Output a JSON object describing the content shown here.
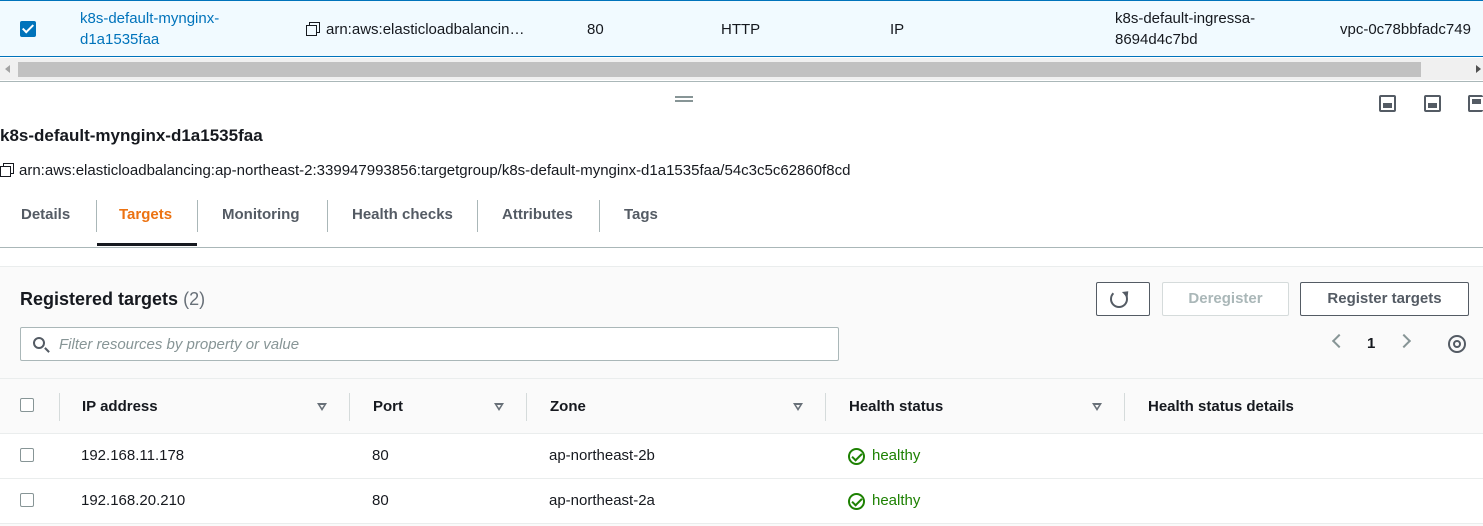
{
  "top_row": {
    "name": "k8s-default-mynginx-d1a1535faa",
    "name_line1": "k8s-default-mynginx-",
    "name_line2": "d1a1535faa",
    "arn": "arn:aws:elasticloadbalancin…",
    "port": "80",
    "protocol": "HTTP",
    "target_type": "IP",
    "load_balancer_line1": "k8s-default-ingressa-",
    "load_balancer_line2": "8694d4c7bd",
    "vpc": "vpc-0c78bbfadc749"
  },
  "detail": {
    "title": "k8s-default-mynginx-d1a1535faa",
    "arn": "arn:aws:elasticloadbalancing:ap-northeast-2:339947993856:targetgroup/k8s-default-mynginx-d1a1535faa/54c3c5c62860f8cd"
  },
  "tabs": [
    {
      "label": "Details"
    },
    {
      "label": "Targets"
    },
    {
      "label": "Monitoring"
    },
    {
      "label": "Health checks"
    },
    {
      "label": "Attributes"
    },
    {
      "label": "Tags"
    }
  ],
  "targets": {
    "title": "Registered targets",
    "count": "(2)",
    "deregister_label": "Deregister",
    "register_label": "Register targets",
    "search_placeholder": "Filter resources by property or value",
    "page": "1",
    "columns": [
      "IP address",
      "Port",
      "Zone",
      "Health status",
      "Health status details"
    ],
    "rows": [
      {
        "ip": "192.168.11.178",
        "port": "80",
        "zone": "ap-northeast-2b",
        "health": "healthy",
        "details": ""
      },
      {
        "ip": "192.168.20.210",
        "port": "80",
        "zone": "ap-northeast-2a",
        "health": "healthy",
        "details": ""
      }
    ]
  },
  "colors": {
    "link": "#0073bb",
    "active_tab": "#ec7211",
    "healthy": "#1d8102"
  }
}
